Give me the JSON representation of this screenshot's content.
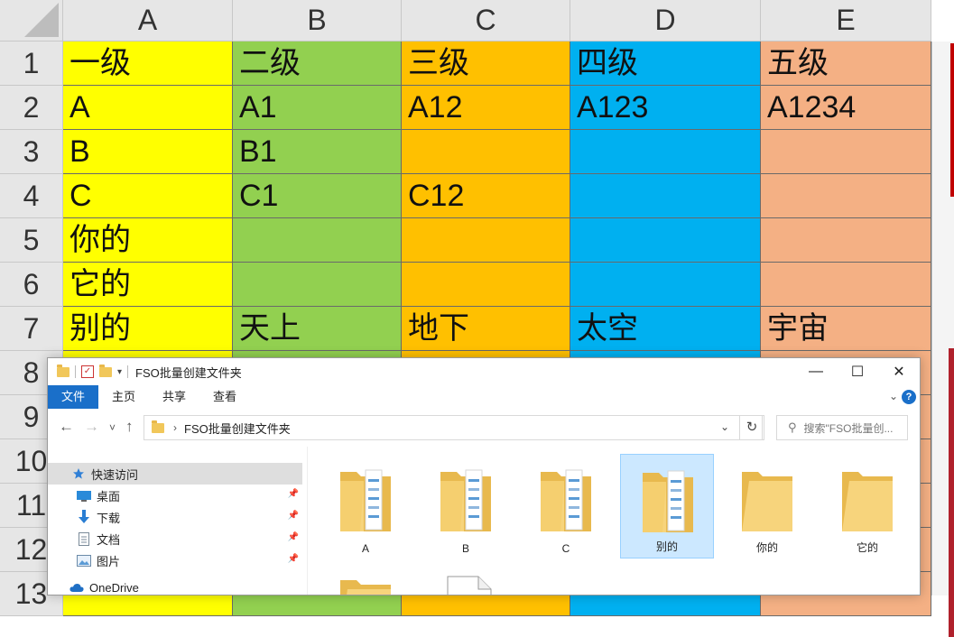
{
  "spreadsheet": {
    "columns": [
      "A",
      "B",
      "C",
      "D",
      "E"
    ],
    "row_numbers": [
      "1",
      "2",
      "3",
      "4",
      "5",
      "6",
      "7",
      "8",
      "9",
      "10",
      "11",
      "12",
      "13"
    ],
    "column_colors": [
      "#ffff00",
      "#92d050",
      "#ffc000",
      "#00b0f0",
      "#f4b084"
    ],
    "rows": [
      [
        "一级",
        "二级",
        "三级",
        "四级",
        "五级"
      ],
      [
        "A",
        "A1",
        "A12",
        "A123",
        "A1234"
      ],
      [
        "B",
        "B1",
        "",
        "",
        ""
      ],
      [
        "C",
        "C1",
        "C12",
        "",
        ""
      ],
      [
        "你的",
        "",
        "",
        "",
        ""
      ],
      [
        "它的",
        "",
        "",
        "",
        ""
      ],
      [
        "别的",
        "天上",
        "地下",
        "太空",
        "宇宙"
      ]
    ]
  },
  "explorer": {
    "title": "FSO批量创建文件夹",
    "window_controls": {
      "minimize": "—",
      "maximize": "☐",
      "close": "✕"
    },
    "ribbon_tabs": [
      "文件",
      "主页",
      "共享",
      "查看"
    ],
    "ribbon_expand": "⌄",
    "help": "?",
    "nav": {
      "back": "←",
      "forward": "→",
      "recent": "˅",
      "up": "↑"
    },
    "address": {
      "separator": "›",
      "path": "FSO批量创建文件夹",
      "dropdown": "⌄"
    },
    "refresh": "↻",
    "search": {
      "icon": "⚲",
      "placeholder": "搜索\"FSO批量创..."
    },
    "nav_pane": [
      {
        "label": "快速访问",
        "icon": "star-icon",
        "selected": true
      },
      {
        "label": "桌面",
        "icon": "desktop-icon",
        "pinned": "📌"
      },
      {
        "label": "下载",
        "icon": "download-icon",
        "pinned": "📌"
      },
      {
        "label": "文档",
        "icon": "document-icon",
        "pinned": "📌"
      },
      {
        "label": "图片",
        "icon": "picture-icon",
        "pinned": "📌"
      },
      {
        "label": "OneDrive",
        "icon": "cloud-icon"
      }
    ],
    "items": [
      {
        "name": "A",
        "type": "folder-with-files"
      },
      {
        "name": "B",
        "type": "folder-with-files"
      },
      {
        "name": "C",
        "type": "folder-with-files"
      },
      {
        "name": "别的",
        "type": "folder-with-files",
        "selected": true
      },
      {
        "name": "你的",
        "type": "folder-empty"
      },
      {
        "name": "它的",
        "type": "folder-empty"
      },
      {
        "name": "",
        "type": "folder-empty"
      },
      {
        "name": "",
        "type": "excel-file"
      }
    ]
  }
}
